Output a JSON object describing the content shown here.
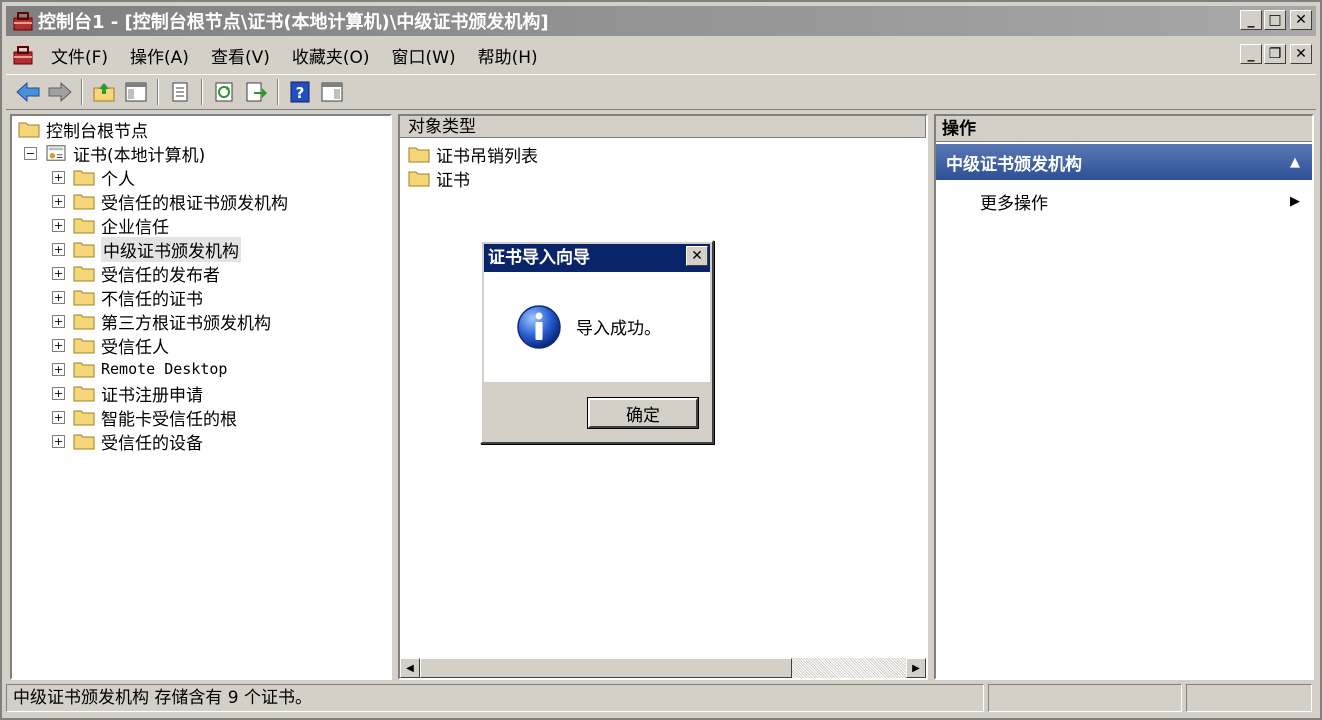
{
  "window": {
    "title": "控制台1 - [控制台根节点\\证书(本地计算机)\\中级证书颁发机构]",
    "minimize": "_",
    "maximize": "□",
    "close": "✕"
  },
  "menubar": {
    "items": [
      "文件(F)",
      "操作(A)",
      "查看(V)",
      "收藏夹(O)",
      "窗口(W)",
      "帮助(H)"
    ],
    "mdi_minimize": "_",
    "mdi_restore": "❐",
    "mdi_close": "✕"
  },
  "toolbar": {
    "icons": [
      "back-icon",
      "forward-icon",
      "up-icon",
      "show-hide-tree-icon",
      "properties-icon",
      "refresh-icon",
      "export-icon",
      "help-icon",
      "show-hide-action-icon"
    ]
  },
  "tree": {
    "root": "控制台根节点",
    "cert_store": "证书(本地计算机)",
    "expanded_symbol": "−",
    "collapsed_symbol": "+",
    "items": [
      "个人",
      "受信任的根证书颁发机构",
      "企业信任",
      "中级证书颁发机构",
      "受信任的发布者",
      "不信任的证书",
      "第三方根证书颁发机构",
      "受信任人",
      "Remote Desktop",
      "证书注册申请",
      "智能卡受信任的根",
      "受信任的设备"
    ],
    "selected_index": 3
  },
  "list": {
    "column": "对象类型",
    "rows": [
      "证书吊销列表",
      "证书"
    ]
  },
  "actions": {
    "header": "操作",
    "section": "中级证书颁发机构",
    "section_arrow": "▲",
    "item": "更多操作",
    "item_arrow": "▶"
  },
  "statusbar": {
    "text": "中级证书颁发机构 存储含有 9 个证书。"
  },
  "dialog": {
    "title": "证书导入向导",
    "close": "✕",
    "message": "导入成功。",
    "ok_label": "确定"
  },
  "colors": {
    "window_bg": "#d4d0c8",
    "dialog_title": "#0a246a",
    "action_section": "#2c4f96",
    "folder": "#f5d67a"
  }
}
